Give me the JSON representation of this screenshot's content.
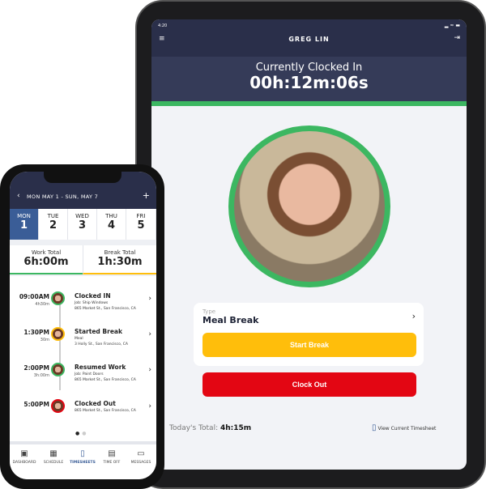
{
  "tablet": {
    "status_time": "4:20",
    "header_title": "GREG LIN",
    "clock_label": "Currently Clocked In",
    "clock_timer": "00h:12m:06s",
    "type_label": "Type",
    "type_value": "Meal Break",
    "start_break": "Start Break",
    "clock_out": "Clock Out",
    "todays_total_label": "Today's Total:",
    "todays_total_value": "4h:15m",
    "view_timesheet": "View Current Timesheet",
    "colors": {
      "header": "#2a2f4a",
      "green": "#3cb761",
      "yellow": "#ffbe0b",
      "red": "#e30613"
    }
  },
  "phone": {
    "date_range": "MON MAY 1 - SUN, MAY 7",
    "days": [
      {
        "d": "MON",
        "n": "1"
      },
      {
        "d": "TUE",
        "n": "2"
      },
      {
        "d": "WED",
        "n": "3"
      },
      {
        "d": "THU",
        "n": "4"
      },
      {
        "d": "FRI",
        "n": "5"
      }
    ],
    "work_total_label": "Work Total",
    "work_total": "6h:00m",
    "break_total_label": "Break Total",
    "break_total": "1h:30m",
    "entries": [
      {
        "time": "09:00AM",
        "dur": "4h30m",
        "title": "Clocked IN",
        "sub1": "Job: Ship Windows",
        "sub2": "865 Market St., San Francisco, CA",
        "color": "#3cb761"
      },
      {
        "time": "1:30PM",
        "dur": "30m",
        "title": "Started Break",
        "sub1": "Meal",
        "sub2": "3 Holly St., San Francisco, CA",
        "color": "#ffbe0b"
      },
      {
        "time": "2:00PM",
        "dur": "3h:00m",
        "title": "Resumed Work",
        "sub1": "Job: Paint Doors",
        "sub2": "865 Market St., San Francisco, CA",
        "color": "#3cb761"
      },
      {
        "time": "5:00PM",
        "dur": "",
        "title": "Clocked Out",
        "sub1": "865 Market St., San Francisco, CA",
        "sub2": "",
        "color": "#e30613"
      }
    ],
    "tabs": [
      {
        "label": "DASHBOARD",
        "icon": "dashboard-icon"
      },
      {
        "label": "SCHEDULE",
        "icon": "calendar-clock-icon"
      },
      {
        "label": "TIMESHEETS",
        "icon": "timesheet-icon",
        "active": true
      },
      {
        "label": "TIME OFF",
        "icon": "calendar-icon"
      },
      {
        "label": "MESSAGES",
        "icon": "chat-icon"
      }
    ]
  }
}
